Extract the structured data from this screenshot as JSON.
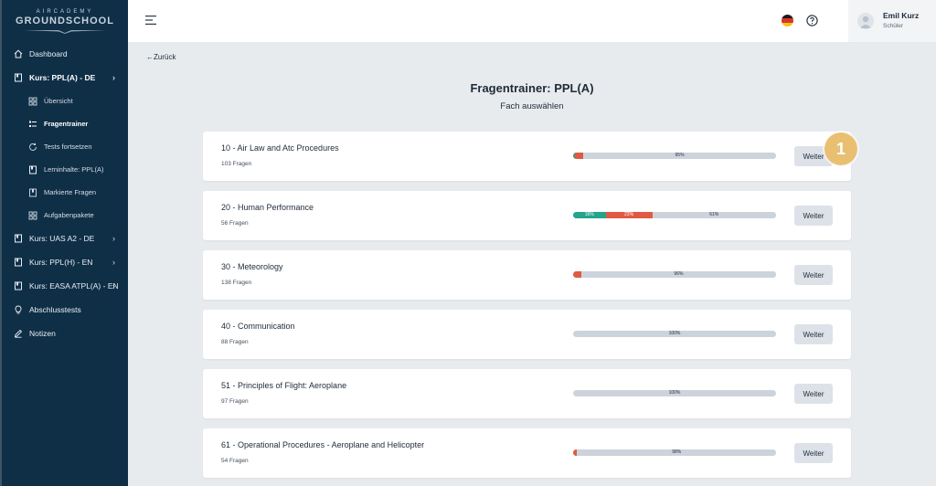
{
  "logo": {
    "line1": "AIRCADEMY",
    "line2": "GROUNDSCHOOL"
  },
  "sidebar": {
    "items": [
      {
        "label": "Dashboard",
        "icon": "home-icon",
        "level": "top"
      },
      {
        "label": "Kurs: PPL(A) - DE",
        "icon": "book-icon",
        "level": "top",
        "active": true,
        "chevron": true
      },
      {
        "label": "Übersicht",
        "icon": "grid-icon",
        "level": "sub"
      },
      {
        "label": "Fragentrainer",
        "icon": "list-icon",
        "level": "sub",
        "active": true
      },
      {
        "label": "Tests fortsetzen",
        "icon": "refresh-icon",
        "level": "sub"
      },
      {
        "label": "Lerninhalte: PPL(A)",
        "icon": "book-icon",
        "level": "sub"
      },
      {
        "label": "Markierte Fragen",
        "icon": "bookmark-icon",
        "level": "sub"
      },
      {
        "label": "Aufgabenpakete",
        "icon": "grid-icon",
        "level": "sub"
      },
      {
        "label": "Kurs: UAS A2 - DE",
        "icon": "book-icon",
        "level": "top",
        "chevron": true
      },
      {
        "label": "Kurs: PPL(H) - EN",
        "icon": "book-icon",
        "level": "top",
        "chevron": true
      },
      {
        "label": "Kurs: EASA ATPL(A) - EN",
        "icon": "book-icon",
        "level": "top",
        "chevron": true
      },
      {
        "label": "Abschlusstests",
        "icon": "bulb-icon",
        "level": "top"
      },
      {
        "label": "Notizen",
        "icon": "pencil-icon",
        "level": "top"
      }
    ]
  },
  "header": {
    "user_name": "Emil Kurz",
    "user_role": "Schüler"
  },
  "main": {
    "back_label": "Zurück",
    "title": "Fragentrainer: PPL(A)",
    "subtitle": "Fach auswählen",
    "button_label": "Weiter",
    "subjects": [
      {
        "name": "10 - Air Law and Atc Procedures",
        "count": "103 Fragen",
        "segments": [
          {
            "color": "green",
            "pct": 1,
            "label": ""
          },
          {
            "color": "red",
            "pct": 4,
            "label": ""
          },
          {
            "color": "gray",
            "pct": 95,
            "label": "95%"
          }
        ]
      },
      {
        "name": "20 - Human Performance",
        "count": "56 Fragen",
        "segments": [
          {
            "color": "green",
            "pct": 16,
            "label": "16%"
          },
          {
            "color": "red",
            "pct": 23,
            "label": "23%"
          },
          {
            "color": "gray",
            "pct": 61,
            "label": "61%"
          }
        ]
      },
      {
        "name": "30 - Meteorology",
        "count": "138 Fragen",
        "segments": [
          {
            "color": "red",
            "pct": 4,
            "label": ""
          },
          {
            "color": "gray",
            "pct": 96,
            "label": "96%"
          }
        ]
      },
      {
        "name": "40 - Communication",
        "count": "88 Fragen",
        "segments": [
          {
            "color": "gray",
            "pct": 100,
            "label": "100%"
          }
        ]
      },
      {
        "name": "51 - Principles of Flight: Aeroplane",
        "count": "97 Fragen",
        "segments": [
          {
            "color": "gray",
            "pct": 100,
            "label": "100%"
          }
        ]
      },
      {
        "name": "61 - Operational Procedures - Aeroplane and Helicopter",
        "count": "54 Fragen",
        "segments": [
          {
            "color": "red",
            "pct": 2,
            "label": ""
          },
          {
            "color": "gray",
            "pct": 98,
            "label": "98%"
          }
        ]
      }
    ]
  },
  "callout": {
    "number": "1"
  },
  "colors": {
    "sidebar": "#0f2f47",
    "green": "#23a48d",
    "red": "#e05a43",
    "gray": "#cdd3db",
    "badge": "#e9c071"
  }
}
